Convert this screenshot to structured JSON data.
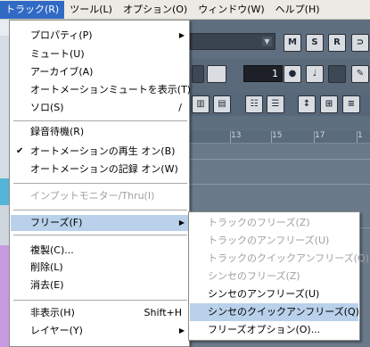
{
  "menubar": {
    "items": [
      {
        "label": "トラック(R)",
        "active": true
      },
      {
        "label": "ツール(L)"
      },
      {
        "label": "オプション(O)"
      },
      {
        "label": "ウィンドウ(W)"
      },
      {
        "label": "ヘルプ(H)"
      }
    ]
  },
  "toolbar": {
    "buttons": [
      "M",
      "S",
      "R"
    ],
    "number_value": "1"
  },
  "ruler": {
    "ticks": [
      "13",
      "15",
      "17",
      "1"
    ]
  },
  "track_menu": {
    "items": [
      {
        "label": "プロパティ(P)",
        "submenu": true
      },
      {
        "label": "ミュート(U)"
      },
      {
        "label": "アーカイブ(A)"
      },
      {
        "label": "オートメーションミュートを表示(T)"
      },
      {
        "label": "ソロ(S)",
        "shortcut": "/"
      },
      {
        "label": "録音待機(R)"
      },
      {
        "label": "オートメーションの再生 オン(B)",
        "checked": true
      },
      {
        "label": "オートメーションの記録 オン(W)"
      },
      {
        "label": "インプットモニター/Thru(I)",
        "disabled": true
      },
      {
        "label": "フリーズ(F)",
        "submenu": true,
        "highlighted": true
      },
      {
        "label": "複製(C)..."
      },
      {
        "label": "削除(L)"
      },
      {
        "label": "消去(E)"
      },
      {
        "label": "非表示(H)",
        "shortcut": "Shift+H"
      },
      {
        "label": "レイヤー(Y)",
        "submenu": true
      }
    ]
  },
  "freeze_submenu": {
    "items": [
      {
        "label": "トラックのフリーズ(Z)",
        "disabled": true
      },
      {
        "label": "トラックのアンフリーズ(U)",
        "disabled": true
      },
      {
        "label": "トラックのクイックアンフリーズ(Q)",
        "disabled": true
      },
      {
        "label": "シンセのフリーズ(Z)",
        "disabled": true
      },
      {
        "label": "シンセのアンフリーズ(U)"
      },
      {
        "label": "シンセのクイックアンフリーズ(Q)",
        "highlighted": true
      },
      {
        "label": "フリーズオプション(O)..."
      }
    ]
  },
  "colors": {
    "menubar_bg": "#eceae4",
    "active_menu": "#316ac5",
    "highlight": "#b9d1ea",
    "disabled_text": "#a0a0a0",
    "app_bg": "#5d6f7f"
  }
}
